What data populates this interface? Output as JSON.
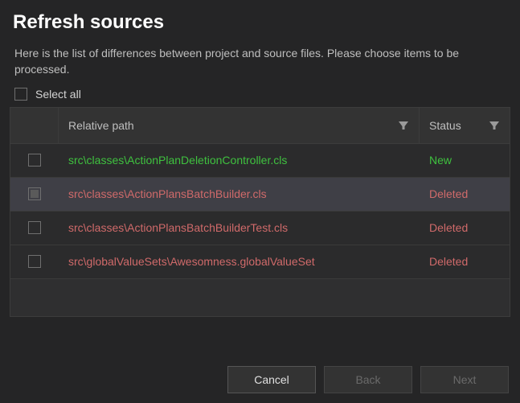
{
  "title": "Refresh sources",
  "description": "Here is the list of differences between project and source files. Please choose items to be processed.",
  "select_all_label": "Select all",
  "columns": {
    "relative_path": "Relative path",
    "status": "Status"
  },
  "rows": [
    {
      "path": "src\\classes\\ActionPlanDeletionController.cls",
      "status": "New",
      "checked": false,
      "selected": false
    },
    {
      "path": "src\\classes\\ActionPlansBatchBuilder.cls",
      "status": "Deleted",
      "checked": "intermediate",
      "selected": true
    },
    {
      "path": "src\\classes\\ActionPlansBatchBuilderTest.cls",
      "status": "Deleted",
      "checked": false,
      "selected": false
    },
    {
      "path": "src\\globalValueSets\\Awesomness.globalValueSet",
      "status": "Deleted",
      "checked": false,
      "selected": false
    }
  ],
  "buttons": {
    "cancel": "Cancel",
    "back": "Back",
    "next": "Next"
  }
}
